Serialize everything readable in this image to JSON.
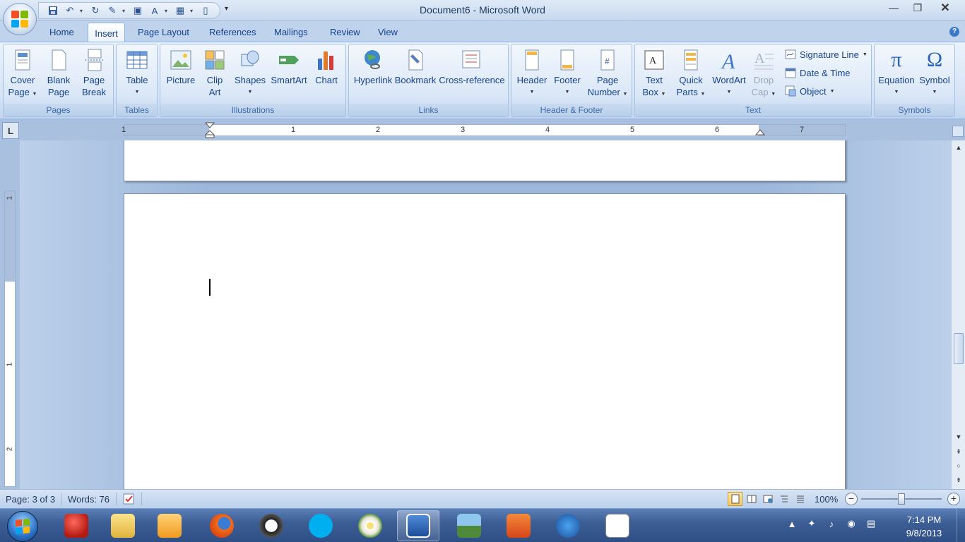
{
  "window": {
    "title": "Document6 - Microsoft Word",
    "minimize": "—",
    "restore": "❐",
    "close": "✕"
  },
  "quick_access": {
    "more": "▾"
  },
  "tabs": {
    "home": "Home",
    "insert": "Insert",
    "page_layout": "Page Layout",
    "references": "References",
    "mailings": "Mailings",
    "review": "Review",
    "view": "View"
  },
  "help": "?",
  "ribbon": {
    "pages": {
      "label": "Pages",
      "cover_page": "Cover",
      "cover_page2": "Page",
      "blank_page": "Blank",
      "blank_page2": "Page",
      "page_break": "Page",
      "page_break2": "Break"
    },
    "tables": {
      "label": "Tables",
      "table": "Table"
    },
    "illustrations": {
      "label": "Illustrations",
      "picture": "Picture",
      "clip_art": "Clip",
      "clip_art2": "Art",
      "shapes": "Shapes",
      "smartart": "SmartArt",
      "chart": "Chart"
    },
    "links": {
      "label": "Links",
      "hyperlink": "Hyperlink",
      "bookmark": "Bookmark",
      "cross_reference": "Cross-reference"
    },
    "header_footer": {
      "label": "Header & Footer",
      "header": "Header",
      "footer": "Footer",
      "page_number": "Page",
      "page_number2": "Number"
    },
    "text": {
      "label": "Text",
      "text_box": "Text",
      "text_box2": "Box",
      "quick_parts": "Quick",
      "quick_parts2": "Parts",
      "wordart": "WordArt",
      "drop_cap": "Drop",
      "drop_cap2": "Cap",
      "signature_line": "Signature Line",
      "date_time": "Date & Time",
      "object": "Object"
    },
    "symbols": {
      "label": "Symbols",
      "equation": "Equation",
      "equation_glyph": "π",
      "symbol": "Symbol",
      "symbol_glyph": "Ω"
    }
  },
  "ruler": {
    "tab_selector": "L",
    "numbers": [
      "1",
      "1",
      "2",
      "3",
      "4",
      "5",
      "6",
      "7"
    ],
    "vnumbers": [
      "1",
      "1",
      "2"
    ]
  },
  "status": {
    "page": "Page: 3 of 3",
    "words": "Words: 76",
    "zoom": "100%",
    "zoom_out": "−",
    "zoom_in": "+"
  },
  "clock": {
    "time": "7:14 PM",
    "date": "9/8/2013"
  },
  "colors": {
    "accent": "#15428b",
    "ribbon_bg": "#d5e4f6",
    "doc_bg": "#9cb7da",
    "taskbar": "#3d5f96"
  }
}
